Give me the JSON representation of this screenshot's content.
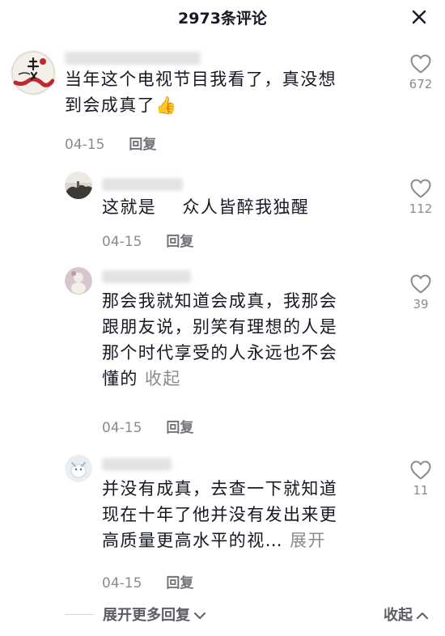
{
  "header": {
    "title": "2973条评论"
  },
  "comments": [
    {
      "text": "当年这个电视节目我看了，真没想\n到会成真了👍",
      "date": "04-15",
      "reply": "回复",
      "likes": "672"
    },
    {
      "text": "这就是    众人皆醉我独醒",
      "date": "04-15",
      "reply": "回复",
      "likes": "112"
    },
    {
      "text": "那会我就知道会成真，我那会\n跟朋友说，别笑有理想的人是\n那个时代享受的人永远也不会\n懂的 ",
      "action": "收起",
      "date": "04-15",
      "reply": "回复",
      "likes": "39"
    },
    {
      "text": "并没有成真，去查一下就知道\n现在十年了他并没有发出来更\n高质量更高水平的视… ",
      "action": "展开",
      "date": "04-15",
      "reply": "回复",
      "likes": "11"
    }
  ],
  "footer": {
    "more_replies": "展开更多回复",
    "collapse": "收起"
  },
  "icons": {
    "close": "close-icon",
    "like": "heart-outline-icon",
    "chevron_down": "chevron-down-icon",
    "chevron_up": "chevron-up-icon"
  },
  "colors": {
    "text": "#161823",
    "muted": "#8a8b91",
    "avatar_red": "#c0282d"
  }
}
